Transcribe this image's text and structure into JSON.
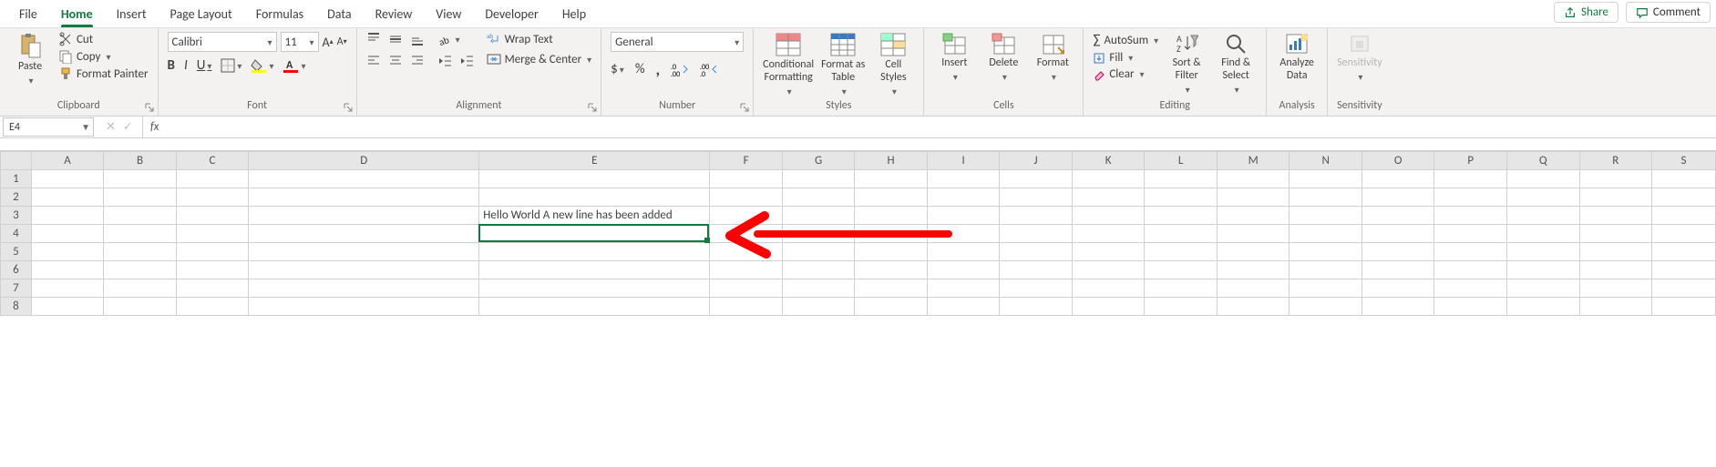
{
  "tabs": {
    "items": [
      "File",
      "Home",
      "Insert",
      "Page Layout",
      "Formulas",
      "Data",
      "Review",
      "View",
      "Developer",
      "Help"
    ],
    "active": "Home",
    "share": "Share",
    "comment": "Comment"
  },
  "ribbon": {
    "clipboard": {
      "paste": "Paste",
      "cut": "Cut",
      "copy": "Copy",
      "format_painter": "Format Painter",
      "label": "Clipboard"
    },
    "font": {
      "name": "Calibri",
      "size": "11",
      "label": "Font"
    },
    "alignment": {
      "wrap": "Wrap Text",
      "merge": "Merge & Center",
      "label": "Alignment"
    },
    "number": {
      "format": "General",
      "label": "Number"
    },
    "styles": {
      "conditional": "Conditional\nFormatting",
      "format_table": "Format as\nTable",
      "cell_styles": "Cell\nStyles",
      "label": "Styles"
    },
    "cells": {
      "insert": "Insert",
      "delete": "Delete",
      "format": "Format",
      "label": "Cells"
    },
    "editing": {
      "autosum": "AutoSum",
      "fill": "Fill",
      "clear": "Clear",
      "sort": "Sort &\nFilter",
      "find": "Find &\nSelect",
      "label": "Editing"
    },
    "analysis": {
      "analyze": "Analyze\nData",
      "label": "Analysis"
    },
    "sensitivity": {
      "sensitivity": "Sensitivity",
      "label": "Sensitivity"
    }
  },
  "formula_bar": {
    "name_box": "E4",
    "fx": "fx",
    "value": ""
  },
  "grid": {
    "columns": [
      "A",
      "B",
      "C",
      "D",
      "E",
      "F",
      "G",
      "H",
      "I",
      "J",
      "K",
      "L",
      "M",
      "N",
      "O",
      "P",
      "Q",
      "R",
      "S"
    ],
    "col_widths": {
      "default": 66,
      "D": 210,
      "E": 210,
      "last": 58
    },
    "rows": 8,
    "active_col": "E",
    "active_row": 4,
    "row3_height": 40,
    "cells": {
      "E3_line1": "Hello World",
      "E3_line2": "A new line has been added"
    }
  },
  "annotation": {
    "arrow_color": "#ff0000"
  }
}
